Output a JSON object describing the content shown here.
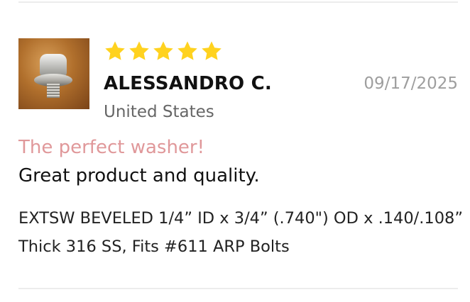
{
  "review": {
    "rating": 5,
    "rating_max": 5,
    "star_color": "#FFD21F",
    "reviewer_name": "ALESSANDRO C.",
    "date": "09/17/2025",
    "location": "United States",
    "title": "The perfect washer!",
    "body": "Great product and quality.",
    "product_name": "EXTSW BEVELED 1/4” ID x 3/4” (.740\") OD x .140/.108” Thick 316 SS, Fits #611 ARP Bolts",
    "colors": {
      "title": "#E0989A",
      "date": "#9E9E9E",
      "location": "#666666"
    }
  }
}
